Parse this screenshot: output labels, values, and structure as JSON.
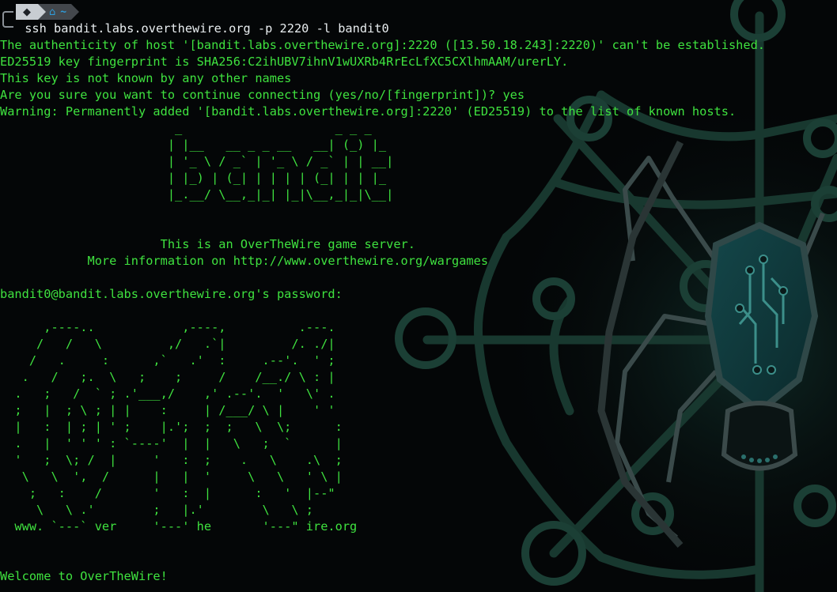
{
  "prompt": {
    "os_icon": "◆",
    "home_icon": "⌂",
    "directory": "~"
  },
  "terminal": {
    "command": " ssh bandit.labs.overthewire.org -p 2220 -l bandit0",
    "output_lines": [
      "The authenticity of host '[bandit.labs.overthewire.org]:2220 ([13.50.18.243]:2220)' can't be established.",
      "ED25519 key fingerprint is SHA256:C2ihUBV7ihnV1wUXRb4RrEcLfXC5CXlhmAAM/urerLY.",
      "This key is not known by any other names",
      "Are you sure you want to continue connecting (yes/no/[fingerprint])? yes",
      "Warning: Permanently added '[bandit.labs.overthewire.org]:2220' (ED25519) to the list of known hosts."
    ],
    "banner_art": "                        _                     _ _ _\n                       | |__   __ _ _ __   __| (_) |_\n                       | '_ \\ / _` | '_ \\ / _` | | __|\n                       | |_) | (_| | | | | (_| | | |_\n                       |_.__/ \\__,_|_| |_|\\__,_|_|\\__|",
    "server_line": "                      This is an OverTheWire game server.",
    "info_line": "            More information on http://www.overthewire.org/wargames",
    "password_prompt": "bandit0@bandit.labs.overthewire.org's password:",
    "otw_art": "      ,----..            ,----,          .---.\n     /   /   \\         ,/   .`|         /. ./|\n    /   .     :      ,`   .'  :     .--'.  ' ;\n   .   /   ;.  \\   ;    ;     /    /__./ \\ : |\n  .   ;   /  ` ; .'___,/    ,' .--'.  '   \\' .\n  ;   |  ; \\ ; | |    :     | /___/ \\ |    ' '\n  |   :  | ; | ' ;    |.';  ;  ;   \\  \\;      :\n  .   |  ' ' ' : `----'  |  |   \\   ;  `      |\n  '   ;  \\; /  |     '   :  ;    .   \\    .\\  ;\n   \\   \\  ',  /      |   |  '     \\   \\   ' \\ |\n    ;   :    /       '   :  |      :   '  |--\"\n     \\   \\ .'        ;   |.'        \\   \\ ;\n  www. `---` ver     '---' he       '---\" ire.org",
    "welcome": "Welcome to OverTheWire!"
  },
  "colors": {
    "background": "#040607",
    "terminal_green": "#3fe23f",
    "command_text": "#e9eef0",
    "wallpaper_accent": "#1c4a3c"
  }
}
